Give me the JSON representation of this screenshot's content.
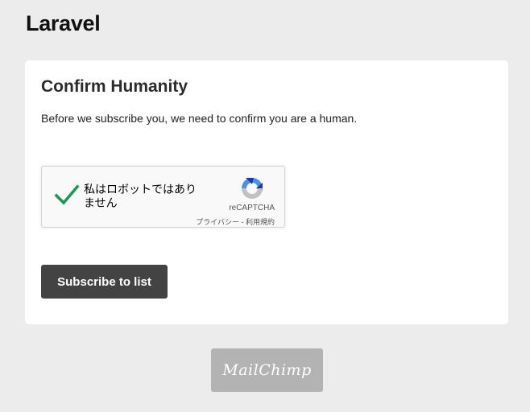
{
  "site": {
    "title": "Laravel"
  },
  "card": {
    "title": "Confirm Humanity",
    "text": "Before we subscribe you, we need to confirm you are a human."
  },
  "recaptcha": {
    "checked": true,
    "label": "私はロボットではありません",
    "brand": "reCAPTCHA",
    "links": "プライバシー - 利用規約",
    "icons": {
      "check": "checkmark-icon",
      "logo": "recaptcha-logo-icon"
    },
    "colors": {
      "check": "#1a9a52",
      "logo_blue": "#4a90e2",
      "logo_dark": "#1c3aa9",
      "logo_grey": "#c1c1c1"
    }
  },
  "form": {
    "submit_label": "Subscribe to list"
  },
  "footer": {
    "badge_text": "MailChimp"
  },
  "colors": {
    "page_bg": "#ececec",
    "card_bg": "#ffffff",
    "button_bg": "#434343",
    "badge_bg": "#b3b3b3"
  }
}
